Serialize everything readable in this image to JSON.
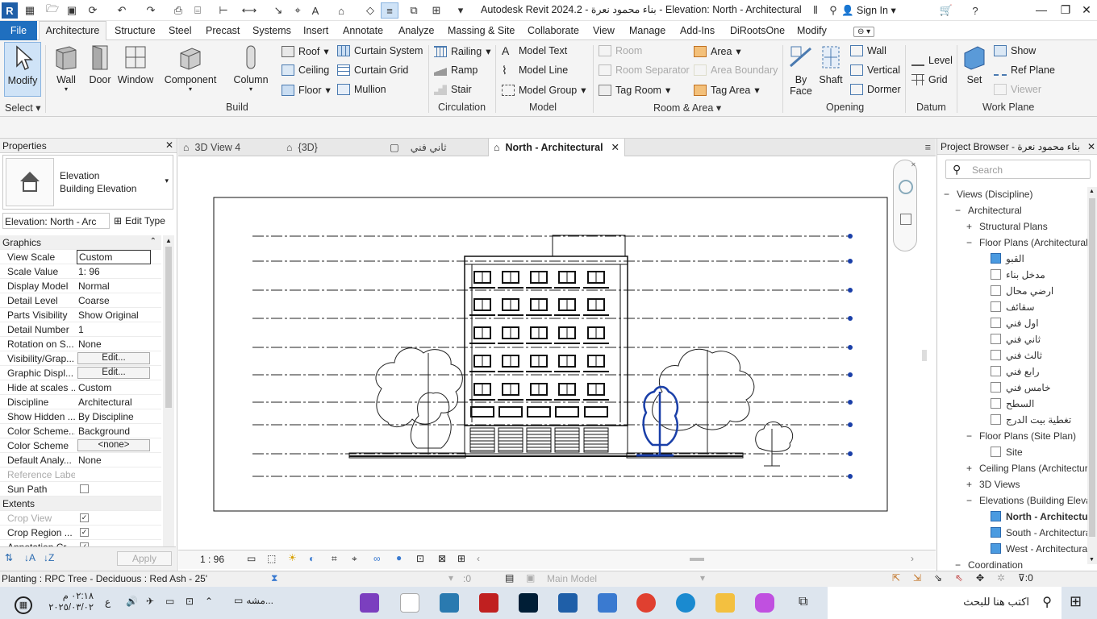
{
  "window": {
    "title": "Autodesk Revit 2024.2 - بناء محمود نعرة - Elevation: North - Architectural",
    "sign_in": "Sign In"
  },
  "ribbon_tabs": [
    "Architecture",
    "Structure",
    "Steel",
    "Precast",
    "Systems",
    "Insert",
    "Annotate",
    "Analyze",
    "Massing & Site",
    "Collaborate",
    "View",
    "Manage",
    "Add-Ins",
    "DiRootsOne",
    "Modify"
  ],
  "file_tab": "File",
  "ribbon": {
    "select": {
      "modify": "Modify",
      "label": "Select ▾"
    },
    "build": {
      "label": "Build",
      "wall": "Wall",
      "door": "Door",
      "window": "Window",
      "component": "Component",
      "column": "Column",
      "roof": "Roof",
      "ceiling": "Ceiling",
      "floor": "Floor",
      "curtain_system": "Curtain System",
      "curtain_grid": "Curtain Grid",
      "mullion": "Mullion"
    },
    "circulation": {
      "label": "Circulation",
      "railing": "Railing",
      "ramp": "Ramp",
      "stair": "Stair"
    },
    "model": {
      "label": "Model",
      "model_text": "Model Text",
      "model_line": "Model Line",
      "model_group": "Model Group"
    },
    "room_area": {
      "label": "Room & Area",
      "room": "Room",
      "room_separator": "Room Separator",
      "tag_room": "Tag Room",
      "area": "Area",
      "area_boundary": "Area Boundary",
      "tag_area": "Tag Area"
    },
    "opening": {
      "label": "Opening",
      "by_face_1": "By",
      "by_face_2": "Face",
      "shaft": "Shaft",
      "wall": "Wall",
      "vertical": "Vertical",
      "dormer": "Dormer"
    },
    "datum": {
      "label": "Datum",
      "level": "Level",
      "grid": "Grid"
    },
    "work_plane": {
      "label": "Work Plane",
      "set": "Set",
      "show": "Show",
      "ref_plane": "Ref Plane",
      "viewer": "Viewer"
    }
  },
  "properties": {
    "title": "Properties",
    "type_line1": "Elevation",
    "type_line2": "Building Elevation",
    "selector": "Elevation: North - Arc",
    "edit_type": "Edit Type",
    "graphics_header": "Graphics",
    "rows": [
      {
        "k": "View Scale",
        "v": "Custom"
      },
      {
        "k": "Scale Value",
        "v": "1:  96"
      },
      {
        "k": "Display Model",
        "v": "Normal"
      },
      {
        "k": "Detail Level",
        "v": "Coarse"
      },
      {
        "k": "Parts Visibility",
        "v": "Show Original"
      },
      {
        "k": "Detail Number",
        "v": "1"
      },
      {
        "k": "Rotation on S...",
        "v": "None"
      },
      {
        "k": "Visibility/Grap...",
        "v": "Edit..."
      },
      {
        "k": "Graphic Displ...",
        "v": "Edit..."
      },
      {
        "k": "Hide at scales ...",
        "v": "Custom"
      },
      {
        "k": "Discipline",
        "v": "Architectural"
      },
      {
        "k": "Show Hidden ...",
        "v": "By Discipline"
      },
      {
        "k": "Color Scheme...",
        "v": "Background"
      },
      {
        "k": "Color Scheme",
        "v": "<none>"
      },
      {
        "k": "Default Analy...",
        "v": "None"
      },
      {
        "k": "Reference Label",
        "v": ""
      },
      {
        "k": "Sun Path",
        "v": ""
      }
    ],
    "extents_header": "Extents",
    "extents_rows": [
      {
        "k": "Crop View",
        "v": ""
      },
      {
        "k": "Crop Region ...",
        "v": ""
      },
      {
        "k": "Annotation Cr...",
        "v": ""
      }
    ],
    "apply": "Apply"
  },
  "doc_tabs": [
    "3D View 4",
    "{3D}",
    "ثاني فني",
    "North - Architectural"
  ],
  "view": {
    "scale": "1 : 96",
    "level_tags": [
      "",
      "",
      "",
      "",
      "",
      "",
      "",
      "",
      "",
      "",
      ""
    ]
  },
  "project_browser": {
    "title": "Project Browser - بناء محمود نعرة",
    "search_placeholder": "Search",
    "nodes": [
      {
        "t": "Views (Discipline)",
        "lvl": 0,
        "sign": "−"
      },
      {
        "t": "Architectural",
        "lvl": 1,
        "sign": "−"
      },
      {
        "t": "Structural Plans",
        "lvl": 2,
        "sign": "+"
      },
      {
        "t": "Floor Plans (Architectural)",
        "lvl": 2,
        "sign": "−"
      },
      {
        "t": "القبو",
        "lvl": 3,
        "chk": "on"
      },
      {
        "t": "مدخل بناء",
        "lvl": 3,
        "chk": "off"
      },
      {
        "t": "ارضي محال",
        "lvl": 3,
        "chk": "off"
      },
      {
        "t": "سقائف",
        "lvl": 3,
        "chk": "off"
      },
      {
        "t": "اول فني",
        "lvl": 3,
        "chk": "off"
      },
      {
        "t": "ثاني فني",
        "lvl": 3,
        "chk": "off"
      },
      {
        "t": "ثالث فني",
        "lvl": 3,
        "chk": "off"
      },
      {
        "t": "رابع فني",
        "lvl": 3,
        "chk": "off"
      },
      {
        "t": "خامس فني",
        "lvl": 3,
        "chk": "off"
      },
      {
        "t": "السطح",
        "lvl": 3,
        "chk": "off"
      },
      {
        "t": "تغطية بيت الدرج",
        "lvl": 3,
        "chk": "off"
      },
      {
        "t": "Floor Plans (Site Plan)",
        "lvl": 2,
        "sign": "−"
      },
      {
        "t": "Site",
        "lvl": 3,
        "chk": "off"
      },
      {
        "t": "Ceiling Plans (Architectural)",
        "lvl": 2,
        "sign": "+"
      },
      {
        "t": "3D Views",
        "lvl": 2,
        "sign": "+"
      },
      {
        "t": "Elevations (Building Elevation)",
        "lvl": 2,
        "sign": "−"
      },
      {
        "t": "North - Architectural",
        "lvl": 3,
        "chk": "on",
        "bold": true
      },
      {
        "t": "South - Architectural",
        "lvl": 3,
        "chk": "on"
      },
      {
        "t": "West - Architectural",
        "lvl": 3,
        "chk": "on"
      },
      {
        "t": "Coordination",
        "lvl": 1,
        "sign": "−"
      }
    ]
  },
  "status": {
    "text": "Planting : RPC Tree - Deciduous : Red Ash - 25'",
    "selection_count": ":0",
    "workset": "Main Model",
    "filter_count": ":0"
  },
  "taskbar": {
    "search_placeholder": "اكتب هنا للبحث",
    "time": "٠٢:١٨ م",
    "date": "٢٠٢٥/٠٣/٠٢",
    "lang": "ع",
    "open_app": "مشه..."
  },
  "colors": {
    "accent": "#1f6fbf",
    "selection": "#1a3fa8"
  }
}
